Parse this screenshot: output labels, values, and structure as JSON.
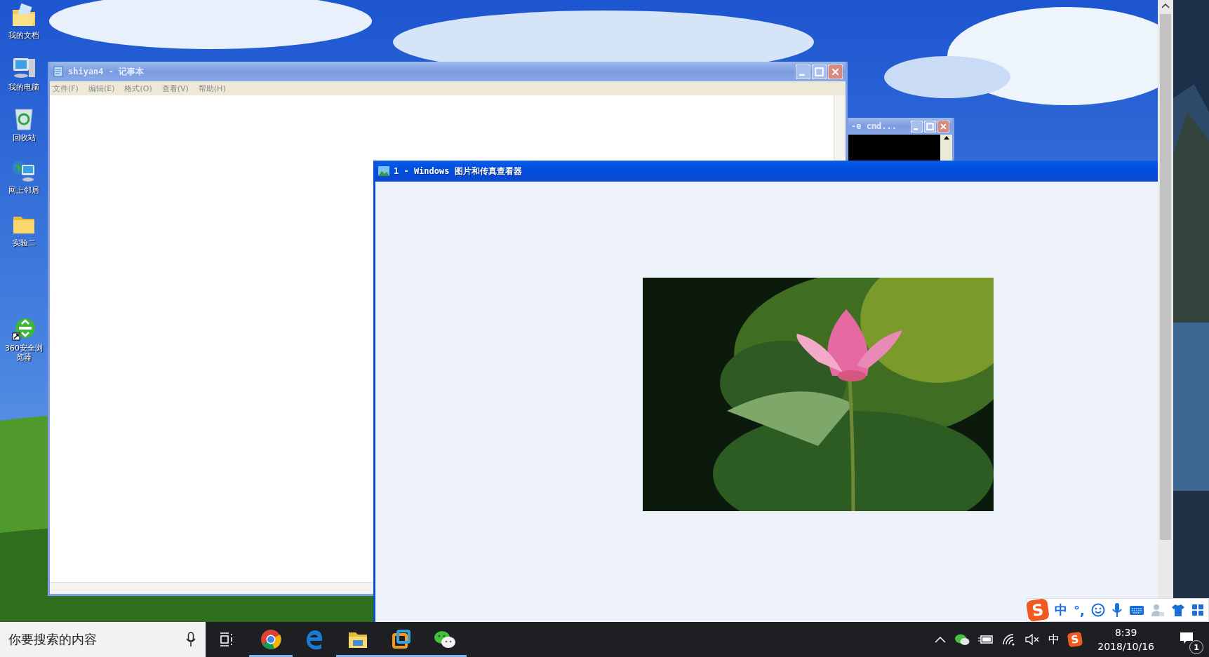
{
  "desktop_icons": [
    {
      "label": "我的文档",
      "kind": "documents"
    },
    {
      "label": "我的电脑",
      "kind": "computer"
    },
    {
      "label": "回收站",
      "kind": "recycle"
    },
    {
      "label": "网上邻居",
      "kind": "network"
    },
    {
      "label": "实验二",
      "kind": "folder"
    },
    {
      "label": "360安全浏览器",
      "kind": "browser"
    }
  ],
  "notepad": {
    "title": "shiyan4 - 记事本",
    "active": false,
    "menu": [
      "文件(F)",
      "编辑(E)",
      "格式(O)",
      "查看(V)",
      "帮助(H)"
    ]
  },
  "cmd_window": {
    "title": "-e cmd...",
    "active": false
  },
  "viewer": {
    "title": "1 - Windows 图片和传真查看器",
    "active": true
  },
  "ime_toolbar": {
    "logo": "S",
    "mode": "中",
    "punctuation": "°,"
  },
  "taskbar": {
    "search": {
      "placeholder": "你要搜索的内容"
    },
    "apps": [
      {
        "kind": "chrome",
        "running": true
      },
      {
        "kind": "edge",
        "running": false
      },
      {
        "kind": "explorer",
        "running": true
      },
      {
        "kind": "vm",
        "running": true
      },
      {
        "kind": "wechat",
        "running": true
      }
    ],
    "tray": {
      "ime": "中",
      "ime_logo": "S",
      "time": "8:39",
      "date": "2018/10/16",
      "notifications": "1"
    }
  }
}
